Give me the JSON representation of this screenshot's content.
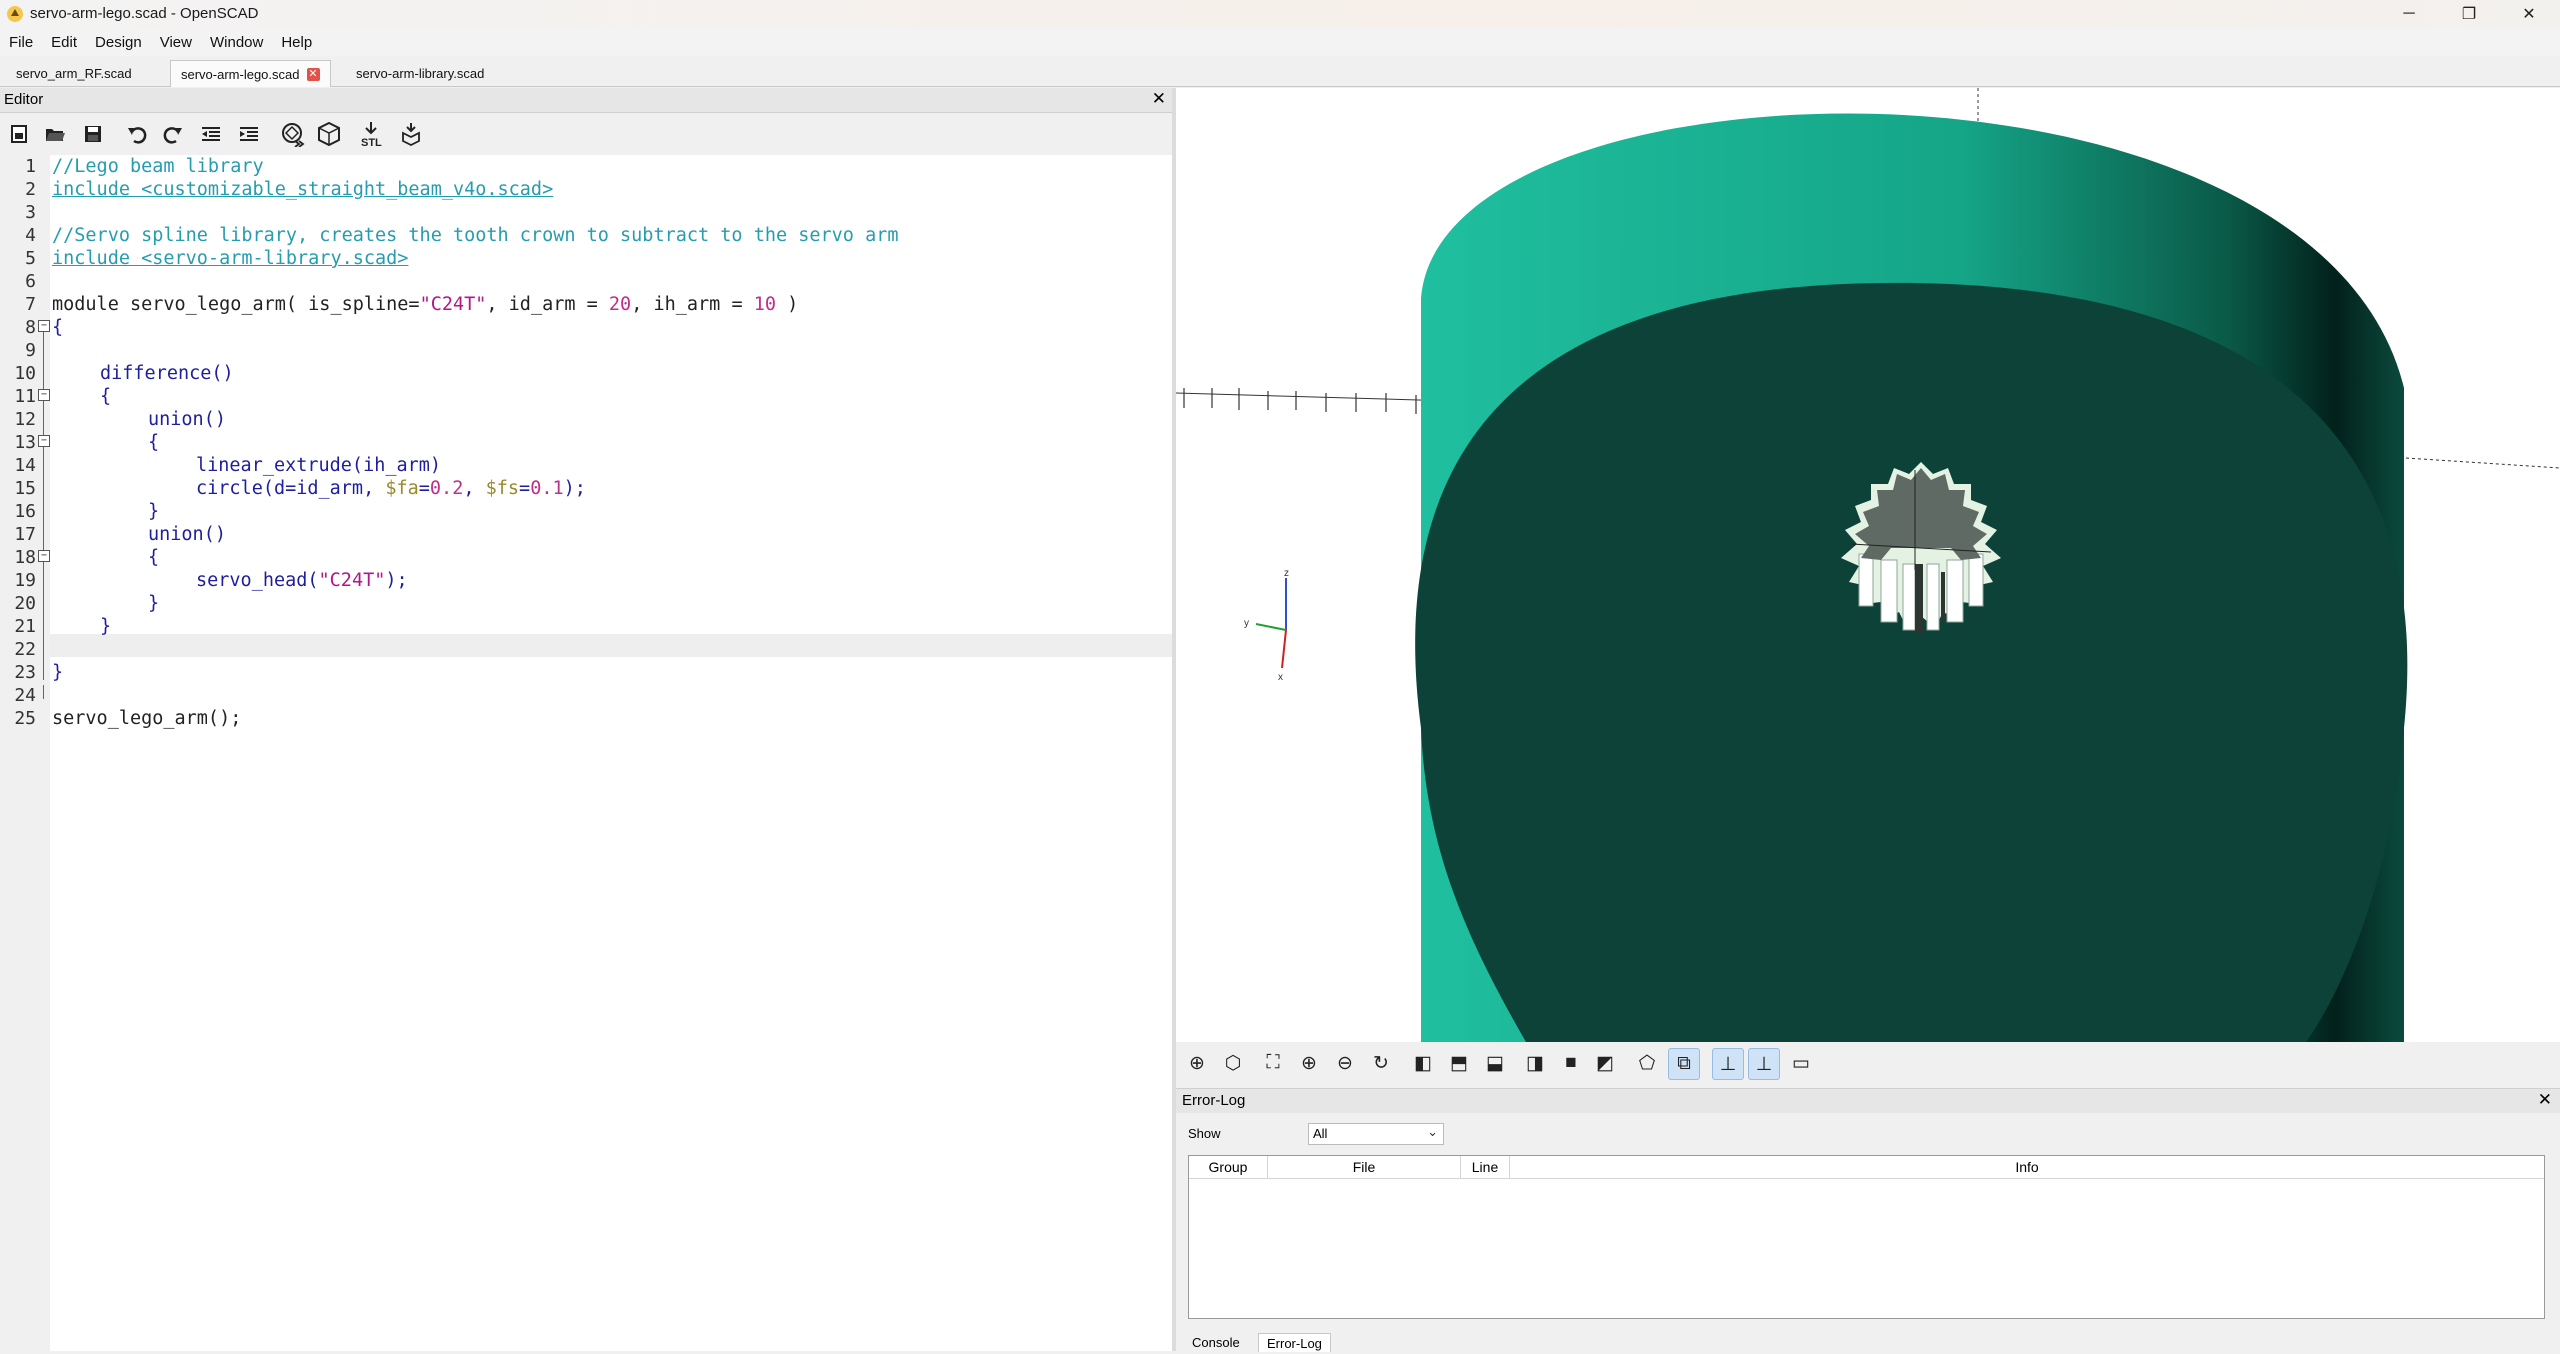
{
  "window": {
    "title": "servo-arm-lego.scad - OpenSCAD",
    "minimize": "─",
    "maximize": "❐",
    "close": "✕"
  },
  "menu": [
    "File",
    "Edit",
    "Design",
    "View",
    "Window",
    "Help"
  ],
  "tabs": [
    {
      "label": "servo_arm_RF.scad",
      "active": false
    },
    {
      "label": "servo-arm-lego.scad",
      "active": true
    },
    {
      "label": "servo-arm-library.scad",
      "active": false
    }
  ],
  "editor": {
    "title": "Editor",
    "close": "✕",
    "current_line": 22,
    "lines": [
      "1",
      "2",
      "3",
      "4",
      "5",
      "6",
      "7",
      "8",
      "9",
      "10",
      "11",
      "12",
      "13",
      "14",
      "15",
      "16",
      "17",
      "18",
      "19",
      "20",
      "21",
      "22",
      "23",
      "24",
      "25"
    ],
    "code": {
      "l1": "//Lego beam library",
      "l2": "include <customizable_straight_beam_v4o.scad>",
      "l4": "//Servo spline library, creates the tooth crown to subtract to the servo arm",
      "l5": "include <servo-arm-library.scad>",
      "l7_a": "module servo_lego_arm( is_spline=",
      "l7_b": "\"C24T\"",
      "l7_c": ", id_arm = ",
      "l7_d": "20",
      "l7_e": ", ih_arm = ",
      "l7_f": "10",
      "l7_g": " )",
      "l8": "{",
      "l10": "difference()",
      "l11": "{",
      "l12": "union()",
      "l13": "{",
      "l14": "linear_extrude(ih_arm)",
      "l15_a": "circle(d=id_arm, ",
      "l15_b": "$fa",
      "l15_c": "=",
      "l15_d": "0.2",
      "l15_e": ", ",
      "l15_f": "$fs",
      "l15_g": "=",
      "l15_h": "0.1",
      "l15_i": ");",
      "l16": "}",
      "l17": "union()",
      "l18": "{",
      "l19_a": "servo_head(",
      "l19_b": "\"C24T\"",
      "l19_c": ");",
      "l20": "}",
      "l21": "}",
      "l23": "}",
      "l25": "servo_lego_arm();"
    }
  },
  "viewport": {
    "colors": {
      "body_light": "#1fbf9f",
      "body_face": "#0c4238",
      "gear_dark": "#5f6a64",
      "gear_light": "#e6f4e8"
    }
  },
  "editor_toolbar_icons": [
    "new-file-icon",
    "open-file-icon",
    "save-icon",
    "undo-icon",
    "redo-icon",
    "unindent-icon",
    "indent-icon",
    "preview-icon",
    "render-icon",
    "export-stl-icon",
    "send-to-print-icon"
  ],
  "view_toolbar_icons": [
    "preview-icon",
    "render-icon",
    "zoom-all-icon",
    "zoom-in-icon",
    "zoom-out-icon",
    "reset-view-icon",
    "view-right-icon",
    "view-top-icon",
    "view-bottom-icon",
    "view-left-icon",
    "view-front-icon",
    "view-back-icon",
    "perspective-icon",
    "orthogonal-icon",
    "show-axes-icon",
    "show-scale-icon",
    "show-edges-icon"
  ],
  "stl_label": "STL",
  "axes_labels": {
    "z": "z",
    "y": "y",
    "x": "x"
  },
  "error_log": {
    "title": "Error-Log",
    "close": "✕",
    "show_label": "Show",
    "show_value": "All",
    "columns": [
      "Group",
      "File",
      "Line",
      "Info"
    ]
  },
  "bottom_tabs": [
    {
      "label": "Console",
      "active": false
    },
    {
      "label": "Error-Log",
      "active": true
    }
  ]
}
